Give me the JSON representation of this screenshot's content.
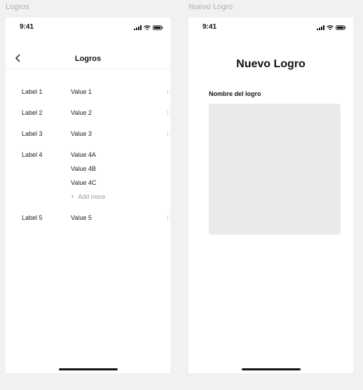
{
  "frames": {
    "left_label": "Logros",
    "right_label": "Nuevo Logro"
  },
  "status_bar": {
    "time": "9:41"
  },
  "logros_screen": {
    "title": "Logros",
    "rows": [
      {
        "label": "Label 1",
        "values": [
          "Value 1"
        ]
      },
      {
        "label": "Label 2",
        "values": [
          "Value 2"
        ]
      },
      {
        "label": "Label 3",
        "values": [
          "Value 3"
        ]
      },
      {
        "label": "Label 4",
        "values": [
          "Value 4A",
          "Value 4B",
          "Value 4C"
        ],
        "add_more": "Add more"
      },
      {
        "label": "Label 5",
        "values": [
          "Value 5"
        ]
      }
    ]
  },
  "nuevo_logro_screen": {
    "title": "Nuevo Logro",
    "field_label": "Nombre del logro",
    "field_value": ""
  },
  "icons": {
    "back": "chevron-left-icon",
    "signal": "cellular-signal-icon",
    "wifi": "wifi-icon",
    "battery": "battery-icon",
    "add": "plus-icon"
  },
  "colors": {
    "canvas": "#f1f1f1",
    "screen": "#ffffff",
    "field_background": "#ebe9e9",
    "muted_text": "#9a9a9a"
  }
}
